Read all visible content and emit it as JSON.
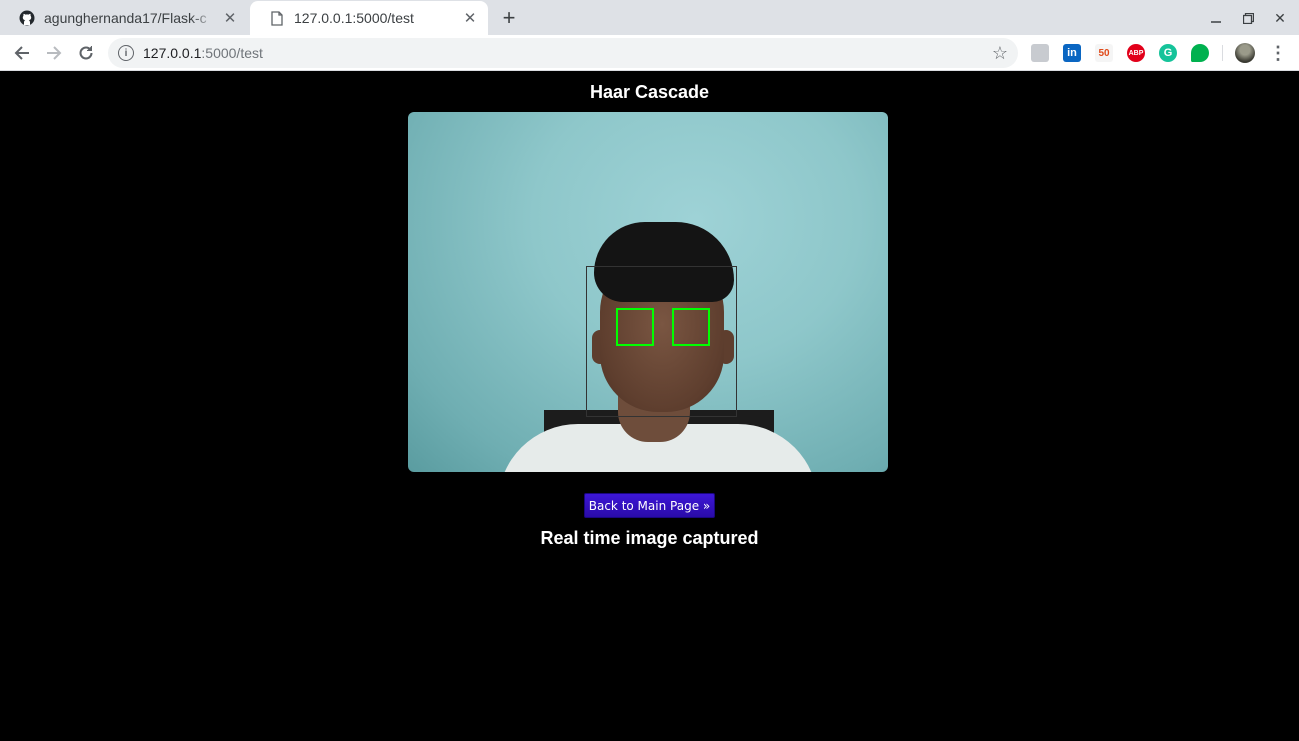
{
  "browser": {
    "tabs": [
      {
        "title": "agunghernanda17/Flask-c",
        "active": false,
        "icon": "github-icon"
      },
      {
        "title": "127.0.0.1:5000/test",
        "active": true,
        "icon": "page-icon"
      }
    ],
    "address": {
      "host": "127.0.0.1",
      "path": ":5000/test"
    },
    "extensions": [
      "photo-extension",
      "linkedin-extension",
      "50-extension",
      "adblock-plus-extension",
      "grammarly-extension",
      "chat-extension"
    ]
  },
  "page": {
    "heading": "Haar Cascade",
    "back_button": "Back to Main Page »",
    "caption": "Real time image captured"
  },
  "colors": {
    "background": "#000000",
    "button": "#2f10c0",
    "eye_box": "#00ff00"
  }
}
